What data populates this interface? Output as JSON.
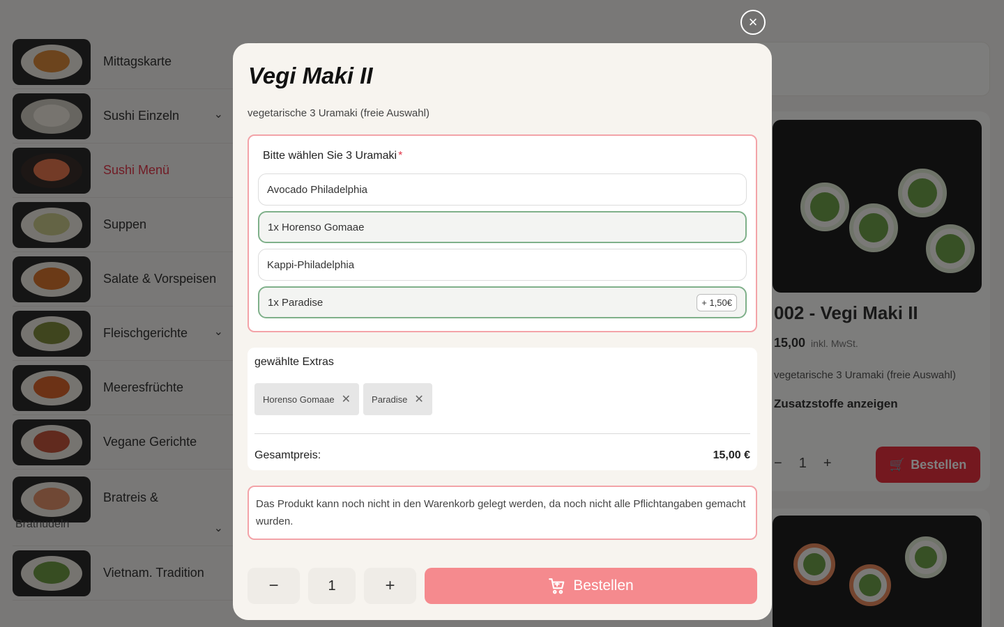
{
  "sidebar": {
    "categories": [
      {
        "label": "Mittagskarte"
      },
      {
        "label": "Sushi Einzeln"
      },
      {
        "label": "Sushi Menü"
      },
      {
        "label": "Suppen"
      },
      {
        "label": "Salate & Vorspeisen"
      },
      {
        "label": "Fleischgerichte"
      },
      {
        "label": "Meeresfrüchte"
      },
      {
        "label": "Vegane Gerichte"
      },
      {
        "label": "Bratreis &",
        "sublabel": "Bratnudeln"
      },
      {
        "label": "Vietnam. Tradition"
      }
    ]
  },
  "background_card": {
    "title": "002 - Vegi Maki II",
    "price": "15,00",
    "price_note": "inkl. MwSt.",
    "desc": "vegetarische 3 Uramaki (freie Auswahl)",
    "allergen_link": "Zusatzstoffe anzeigen",
    "qty_minus": "−",
    "qty_value": "1",
    "qty_plus": "+",
    "order_label": "Bestellen"
  },
  "modal": {
    "close_icon": "×",
    "title": "Vegi Maki II",
    "description": "vegetarische 3 Uramaki (freie Auswahl)",
    "group_label": "Bitte wählen Sie 3 Uramaki",
    "required_mark": "*",
    "options": [
      {
        "label": "Avocado Philadelphia",
        "selected": false,
        "surcharge": ""
      },
      {
        "label": "1x Horenso Gomaae",
        "selected": true,
        "surcharge": ""
      },
      {
        "label": "Kappi-Philadelphia",
        "selected": false,
        "surcharge": ""
      },
      {
        "label": "1x Paradise",
        "selected": true,
        "surcharge": "+ 1,50€"
      }
    ],
    "extras_title": "gewählte Extras",
    "chips": [
      {
        "label": "Horenso Gomaae"
      },
      {
        "label": "Paradise"
      }
    ],
    "chip_remove": "✕",
    "total_label": "Gesamtpreis:",
    "total_amount": "15,00 €",
    "notice": "Das Produkt kann noch nicht in den Warenkorb gelegt werden, da noch nicht alle Pflichtangaben gemacht wurden.",
    "qty_minus": "−",
    "qty_value": "1",
    "qty_plus": "+",
    "order_label": "Bestellen",
    "order_icon": "cart-icon"
  },
  "colors": {
    "accent": "#e0374a",
    "order_button_disabled": "#f58a8e",
    "selected_border": "#7fb08a",
    "group_border": "#f3a3a8"
  }
}
